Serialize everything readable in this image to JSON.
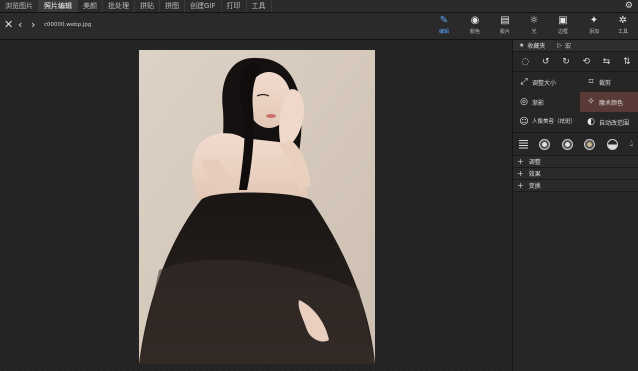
{
  "menu": {
    "items": [
      "浏览图片",
      "照片编辑",
      "美颜",
      "批处理",
      "拼贴",
      "拼图",
      "创建GIF",
      "打印",
      "工具"
    ],
    "active_index": 1
  },
  "toolbar": {
    "filename": "c00000.webp.jpg",
    "tools": [
      {
        "label": "编辑",
        "icon": "edit-icon",
        "glyph": "✎"
      },
      {
        "label": "颜色",
        "icon": "color-circle-icon",
        "glyph": "◉"
      },
      {
        "label": "胶片",
        "icon": "film-icon",
        "glyph": "▤"
      },
      {
        "label": "光",
        "icon": "light-icon",
        "glyph": "☼"
      },
      {
        "label": "边框",
        "icon": "frame-icon",
        "glyph": "▣"
      },
      {
        "label": "添加",
        "icon": "add-sparkle-icon",
        "glyph": "✦"
      },
      {
        "label": "工具",
        "icon": "tools-icon",
        "glyph": "✲"
      }
    ]
  },
  "panel": {
    "tab_favorites": "收藏夹",
    "tab_macro": "宏",
    "tools": [
      {
        "label": "调整大小",
        "glyph": "⤢",
        "icon": "resize-icon"
      },
      {
        "label": "裁剪",
        "glyph": "⌗",
        "icon": "crop-icon"
      },
      {
        "label": "渐影",
        "glyph": "◎",
        "icon": "vignette-icon"
      },
      {
        "label": "魔术颜色",
        "glyph": "✧",
        "icon": "magic-wand-icon"
      },
      {
        "label": "人像美容（祛斑）",
        "glyph": "☺",
        "icon": "portrait-icon"
      },
      {
        "label": "自动改范围",
        "glyph": "◐",
        "icon": "auto-range-icon"
      }
    ],
    "sections": [
      "调整",
      "效果",
      "变换"
    ]
  }
}
